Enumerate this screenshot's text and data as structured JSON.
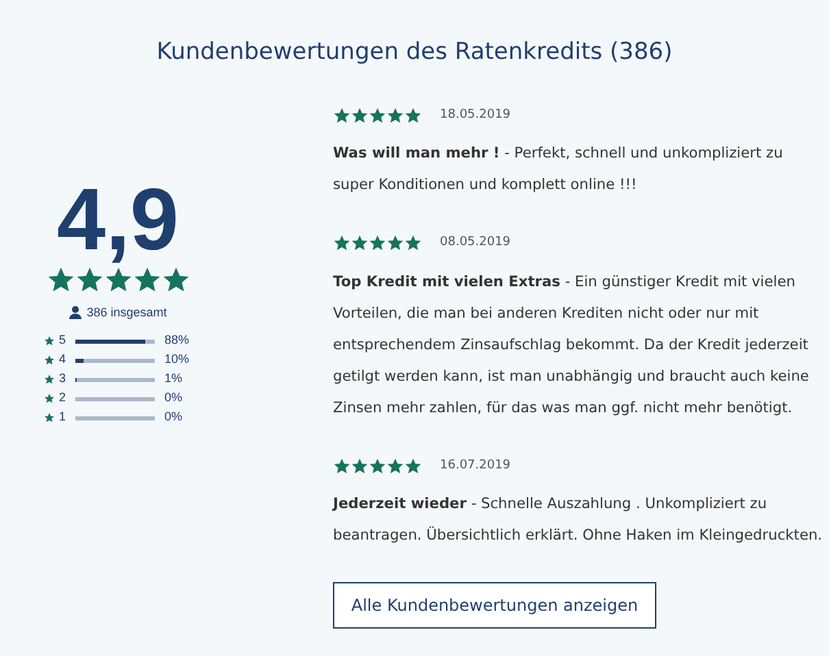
{
  "title": "Kundenbewertungen des Ratenkredits (386)",
  "summary": {
    "score": "4,9",
    "stars": 5,
    "total": "386 insgesamt",
    "distribution": [
      {
        "label": "5",
        "level": 0.88,
        "percent": "88%"
      },
      {
        "label": "4",
        "level": 0.1,
        "percent": "10%"
      },
      {
        "label": "3",
        "level": 0.01,
        "percent": "1%"
      },
      {
        "label": "2",
        "level": 0,
        "percent": "0%"
      },
      {
        "label": "1",
        "level": 0,
        "percent": "0%"
      }
    ]
  },
  "reviews": [
    {
      "stars": 5,
      "date": "18.05.2019",
      "text": "**Was will man mehr !** - Perfekt, schnell und unkompliziert zu super Konditionen und komplett online !!!"
    },
    {
      "stars": 5,
      "date": "08.05.2019",
      "text": "**Top Kredit mit vielen Extras** - Ein günstiger Kredit mit vielen Vorteilen, die man bei anderen Krediten nicht oder nur mit entsprechendem Zinsaufschlag bekommt. Da der Kredit jederzeit getilgt werden kann, ist man unabhängig und braucht auch keine Zinsen mehr zahlen, für das was man ggf. nicht mehr benötigt."
    },
    {
      "stars": 5,
      "date": "16.07.2019",
      "text": "**Jederzeit wieder** - Schnelle Auszahlung . Unkompliziert zu beantragen. Übersichtlich erklärt. Ohne Haken im Kleingedruckten."
    }
  ],
  "button": "Alle Kundenbewertungen anzeigen"
}
